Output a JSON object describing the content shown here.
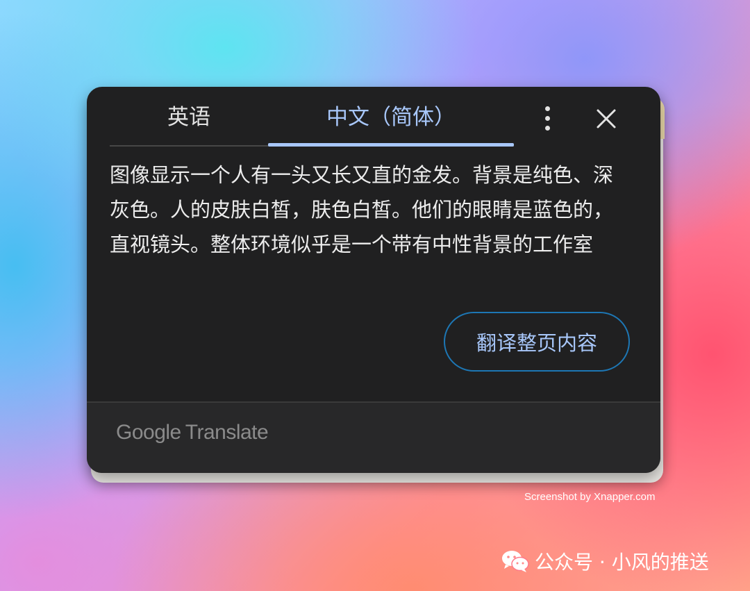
{
  "popup": {
    "tabs": [
      {
        "label": "英语"
      },
      {
        "label": "中文（简体）"
      }
    ],
    "translation_text": "图像显示一个人有一头又长又直的金发。背景是纯色、深灰色。人的皮肤白皙，肤色白皙。他们的眼睛是蓝色的，直视镜头。整体环境似乎是一个带有中性背景的工作室",
    "translate_page_label": "翻译整页内容",
    "footer": {
      "brand_google": "Google",
      "brand_translate": "Translate"
    }
  },
  "watermark": "Screenshot by Xnapper.com",
  "account_label": "公众号 · 小风的推送",
  "colors": {
    "popup_bg": "#202021",
    "active_tab": "#a8c7fa",
    "button_border": "#1d77b5",
    "text": "#ededed"
  },
  "icons": [
    "more-vert-icon",
    "close-icon",
    "wechat-icon"
  ]
}
